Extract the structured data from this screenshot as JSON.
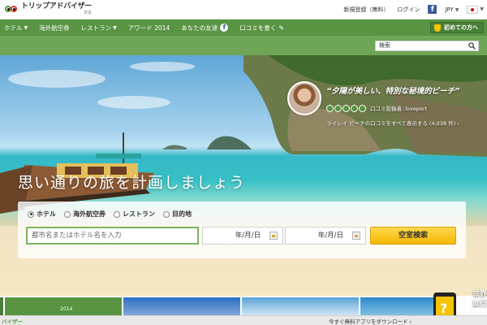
{
  "header": {
    "logo_main": "トリップアドバイザー",
    "logo_sub": "日本",
    "register": "新規登録（無料）",
    "login": "ログイン",
    "fb_letter": "f",
    "currency": "JPY"
  },
  "nav": {
    "items": [
      "ホテル",
      "海外航空券",
      "レストラン",
      "アワード 2014",
      "あなたの友達",
      "口コミを書く"
    ],
    "first_time": "初めての方へ"
  },
  "site_search": {
    "placeholder": "検索"
  },
  "hero": {
    "title": "思い通りの旅を計画しましょう",
    "review": {
      "quote": "“夕陽が美しい、特別な秘境的ビーチ”",
      "poster": "口コミ投稿者: loveport",
      "all_reviews": "ライレイ ビーチの口コミをすべて表示する (4,038 件) ›",
      "rating": 5
    }
  },
  "search_panel": {
    "radios": [
      "ホテル",
      "海外航空券",
      "レストラン",
      "目的地"
    ],
    "selected": "ホテル",
    "destination_placeholder": "都市名またはホテル名を入力",
    "checkin": "年/月/日",
    "checkout": "年/月/日",
    "submit": "空室検索"
  },
  "tiles": {
    "award_year": "2014",
    "promo_line1": "世界",
    "promo_line2": "旅行"
  },
  "bottom": {
    "left": "バイザー",
    "app_download": "今すぐ無料アプリをダウンロード ›"
  },
  "colors": {
    "brand_green": "#589442",
    "search_yellow": "#f4b800",
    "facebook": "#3b5998"
  }
}
